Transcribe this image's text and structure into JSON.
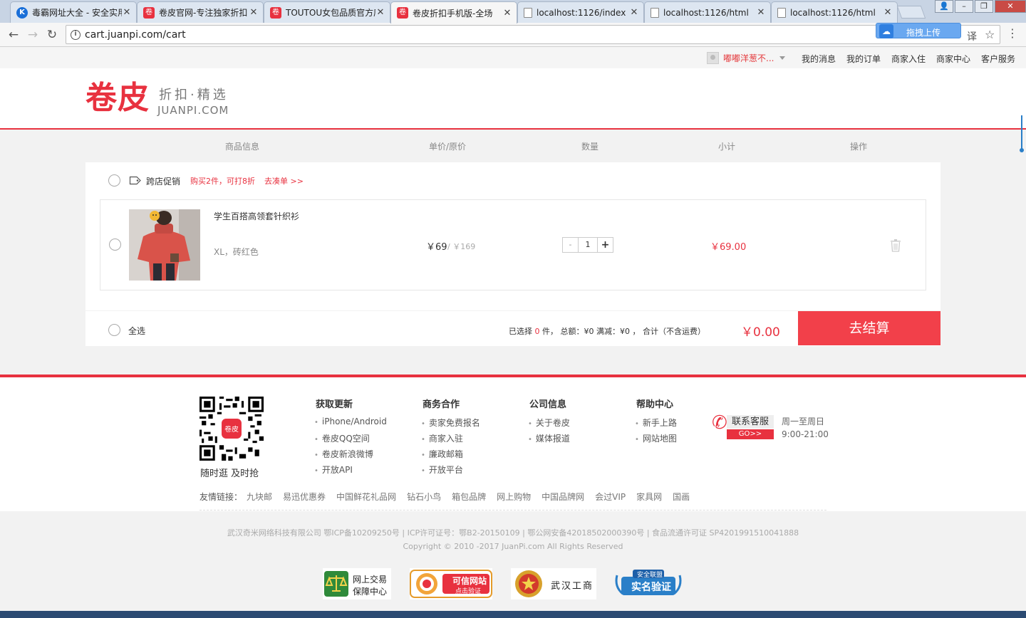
{
  "browser": {
    "tabs": [
      {
        "title": "毒霸网址大全 - 安全实用的网址导航",
        "favicon": "k-icon",
        "active": false
      },
      {
        "title": "卷皮官网-专注独家折扣",
        "favicon": "juanpi-icon",
        "active": false
      },
      {
        "title": "TOUTOU女包品质官方店",
        "favicon": "juanpi-icon",
        "active": false
      },
      {
        "title": "卷皮折扣手机版-全场",
        "favicon": "juanpi-icon",
        "active": true
      },
      {
        "title": "localhost:1126/index",
        "favicon": "page-icon",
        "active": false
      },
      {
        "title": "localhost:1126/html",
        "favicon": "page-icon",
        "active": false
      },
      {
        "title": "localhost:1126/html",
        "favicon": "page-icon",
        "active": false
      }
    ],
    "url": "cart.juanpi.com/cart",
    "upload_button": "拖拽上传"
  },
  "topbar": {
    "username": "嘟嘟洋葱不...",
    "links": [
      "我的消息",
      "我的订单",
      "商家入住",
      "商家中心",
      "客户服务"
    ]
  },
  "header": {
    "logo_text": "卷皮",
    "slogan": "折扣·精选",
    "domain": "JUANPI.COM"
  },
  "cart": {
    "columns": [
      "商品信息",
      "单价/原价",
      "数量",
      "小计",
      "操作"
    ],
    "promo": {
      "label": "跨店促销",
      "text": "购买2件，可打8折",
      "link": "去凑单 >>"
    },
    "item": {
      "name": "学生百搭高领套针织衫",
      "spec": "XL，砖红色",
      "price": "￥69",
      "original_price": "/ ￥169",
      "quantity": "1",
      "minus": "-",
      "plus": "+",
      "subtotal": "￥69.00"
    },
    "footer": {
      "select_all": "全选",
      "selected_prefix": "已选择",
      "selected_count": "0",
      "selected_suffix": "件，  总额：¥0    满减：¥0  ，  合计（不含运费）",
      "total": "￥0.00",
      "checkout": "去结算"
    }
  },
  "footer": {
    "qr_caption": "随时逛 及时抢",
    "columns": [
      {
        "title": "获取更新",
        "items": [
          "iPhone/Android",
          "卷皮QQ空间",
          "卷皮新浪微博",
          "开放API"
        ]
      },
      {
        "title": "商务合作",
        "items": [
          "卖家免费报名",
          "商家入驻",
          "廉政邮箱",
          "开放平台"
        ]
      },
      {
        "title": "公司信息",
        "items": [
          "关于卷皮",
          "媒体报道"
        ]
      },
      {
        "title": "帮助中心",
        "items": [
          "新手上路",
          "网站地图"
        ]
      }
    ],
    "service": {
      "label": "联系客服",
      "go": "GO>>",
      "hours_line1": "周一至周日",
      "hours_line2": "9:00-21:00"
    },
    "friend_links_label": "友情链接：",
    "friend_links": [
      "九块邮",
      "易迅优惠券",
      "中国鲜花礼品网",
      "钻石小鸟",
      "箱包品牌",
      "网上购物",
      "中国品牌网",
      "会过VIP",
      "家具网",
      "国画"
    ],
    "copyright1": "武汉奇米网络科技有限公司 鄂ICP备10209250号 | ICP许可证号：鄂B2-20150109 | 鄂公网安备42018502000390号 | 食品流通许可证 SP4201991510041888",
    "copyright2": "Copyright © 2010 -2017 JuanPi.com All Rights Reserved",
    "badges": {
      "trade_line1": "网上交易",
      "trade_line2": "保障中心",
      "credible_line1": "可信网站",
      "credible_line2": "点击验证",
      "gongshang": "武汉工商",
      "realname_top": "安全联盟",
      "realname": "实名验证"
    }
  },
  "colors": {
    "brand_red": "#e8313f",
    "checkout_red": "#f2404a"
  }
}
